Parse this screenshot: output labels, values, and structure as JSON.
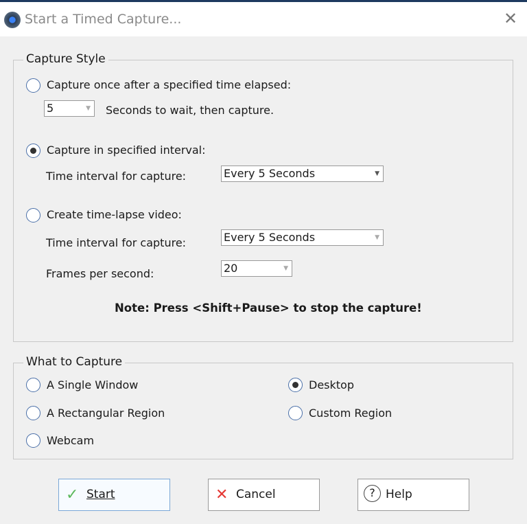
{
  "window": {
    "title": "Start a Timed Capture...",
    "close_icon": "close-icon"
  },
  "capture_style": {
    "legend": "Capture Style",
    "once": {
      "label": "Capture once after a specified time elapsed:",
      "selected": false,
      "seconds": "5",
      "seconds_label": "Seconds to wait, then capture."
    },
    "interval": {
      "label": "Capture in specified interval:",
      "selected": true,
      "interval_label": "Time interval for capture:",
      "interval_value": "Every 5 Seconds"
    },
    "timelapse": {
      "label": "Create time-lapse video:",
      "selected": false,
      "interval_label": "Time interval for capture:",
      "interval_value": "Every 5 Seconds",
      "fps_label": "Frames per second:",
      "fps_value": "20"
    },
    "note": "Note: Press <Shift+Pause> to stop the capture!"
  },
  "what_to_capture": {
    "legend": "What to Capture",
    "options": [
      {
        "label": "A Single Window",
        "selected": false
      },
      {
        "label": "A Rectangular Region",
        "selected": false
      },
      {
        "label": "Webcam",
        "selected": false
      },
      {
        "label": "Desktop",
        "selected": true
      },
      {
        "label": "Custom Region",
        "selected": false
      }
    ]
  },
  "buttons": {
    "start": "Start",
    "cancel": "Cancel",
    "help": "Help"
  }
}
